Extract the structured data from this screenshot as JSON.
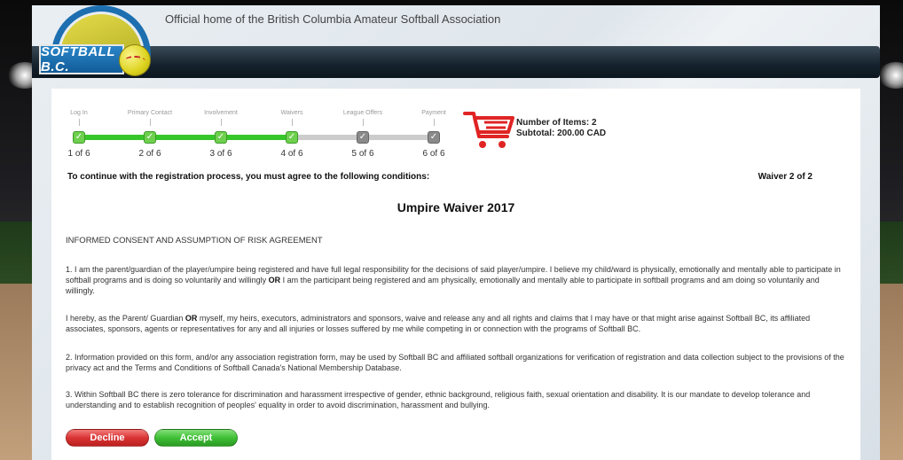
{
  "header": {
    "logo_text": "SOFTBALL B.C.",
    "tagline": "Official home of the British Columbia Amateur Softball Association"
  },
  "progress": {
    "steps": [
      {
        "label": "Log In",
        "count": "1 of 6",
        "complete": true
      },
      {
        "label": "Primary Contact",
        "count": "2 of 6",
        "complete": true
      },
      {
        "label": "Involvement",
        "count": "3 of 6",
        "complete": true
      },
      {
        "label": "Waivers",
        "count": "4 of 6",
        "complete": true
      },
      {
        "label": "League Offers",
        "count": "5 of 6",
        "complete": false
      },
      {
        "label": "Payment",
        "count": "6 of 6",
        "complete": false
      }
    ],
    "completed_fraction": 0.6
  },
  "cart": {
    "items": "Number of Items: 2",
    "subtotal": "Subtotal: 200.00 CAD",
    "icon": "shopping-cart-icon",
    "color": "#e02424"
  },
  "conditions": "To continue with the registration process, you must agree to the following conditions:",
  "waiver_count": "Waiver 2 of 2",
  "title": "Umpire Waiver 2017",
  "heading": "INFORMED CONSENT AND ASSUMPTION OF RISK AGREEMENT",
  "paragraphs": [
    {
      "before": "1. I am the parent/guardian of the player/umpire being registered and have full legal responsibility for the decisions of said player/umpire. I believe my child/ward is physically, emotionally and mentally able to participate in softball programs and is doing so voluntarily and willingly ",
      "bold": "OR",
      "after": " I am the participant being registered and am physically, emotionally and mentally able to participate in softball programs and am doing so voluntarily and willingly."
    },
    {
      "before": "I hereby, as the Parent/ Guardian ",
      "bold": "OR",
      "after": " myself, my heirs, executors, administrators and sponsors, waive and release any and all rights and claims that I may have or that might arise against Softball BC, its affiliated associates, sponsors, agents or representatives for any and all injuries or losses suffered by me while competing in or connection with the programs of Softball BC."
    },
    {
      "before": "2. Information provided on this form, and/or any association registration form, may be used by Softball BC and affiliated softball organizations for verification of registration and data collection subject to the provisions of the privacy act and the Terms and Conditions of Softball Canada's National Membership Database.",
      "bold": "",
      "after": ""
    },
    {
      "before": "3. Within Softball BC there is zero tolerance for discrimination and harassment irrespective of gender, ethnic background, religious faith, sexual orientation and disability. It is our mandate to develop tolerance and understanding and to establish recognition of peoples' equality in order to avoid discrimination, harassment and bullying.",
      "bold": "",
      "after": ""
    }
  ],
  "buttons": {
    "decline": "Decline",
    "accept": "Accept"
  },
  "colors": {
    "progress_complete": "#37c629",
    "decline": "#d93434",
    "accept": "#3fbf36",
    "navbar": "#15222d"
  }
}
